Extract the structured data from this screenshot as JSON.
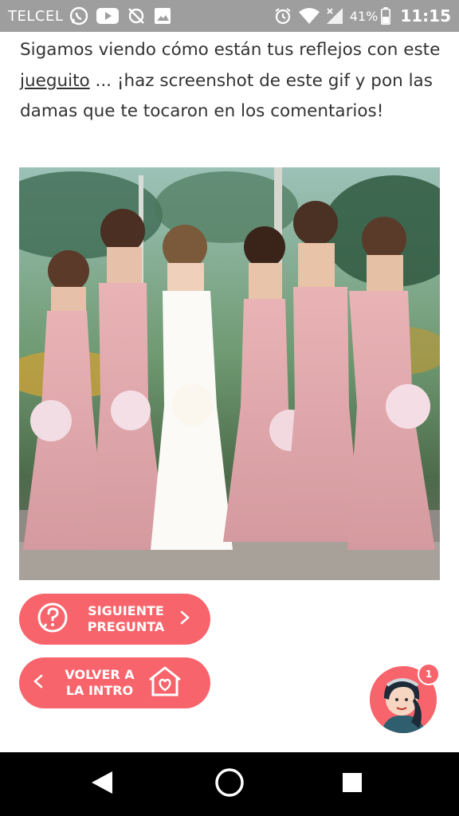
{
  "status_bar": {
    "carrier": "TELCEL",
    "battery": "41%",
    "time": "11:15",
    "icons": [
      "whatsapp-icon",
      "youtube-icon",
      "sync-off-icon",
      "image-icon",
      "alarm-icon",
      "wifi-icon",
      "signal-icon",
      "battery-icon"
    ]
  },
  "article": {
    "text_before": "Sigamos viendo cómo están tus reflejos con este ",
    "link_text": "jueguito",
    "text_after": " ... ¡haz screenshot de este gif y pon las damas que te tocaron en los comentarios!"
  },
  "buttons": {
    "next_label": "SIGUIENTE PREGUNTA",
    "back_label": "VOLVER A LA INTRO"
  },
  "assistant": {
    "badge_count": "1"
  },
  "colors": {
    "accent": "#f8646b",
    "status_bar": "#9e9e9e",
    "text": "#333333",
    "nav_bar": "#000000"
  }
}
